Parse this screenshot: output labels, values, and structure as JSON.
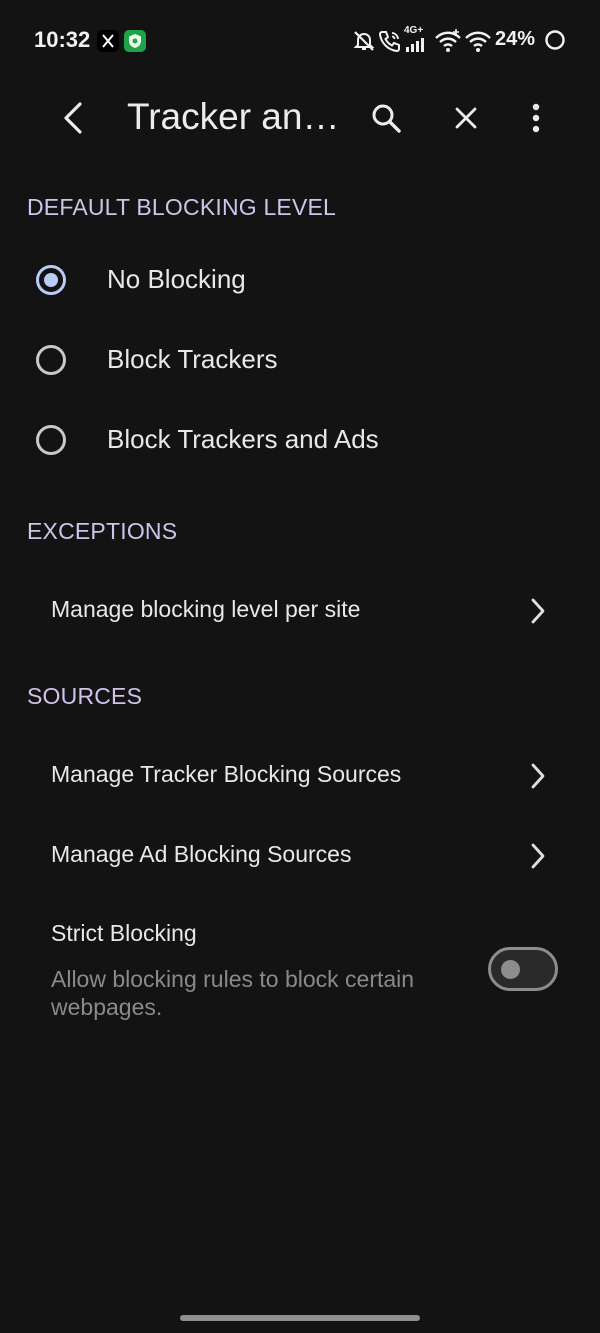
{
  "status_bar": {
    "time": "10:32",
    "network_label": "4G+",
    "battery": "24%",
    "icons": [
      "x-app-icon",
      "shield-app-icon",
      "mute-icon",
      "wifi-calling-icon",
      "signal-icon",
      "hotspot-icon",
      "wifi-icon",
      "battery-ring-icon"
    ]
  },
  "app_bar": {
    "title": "Tracker an…",
    "back_icon": "back-arrow-icon",
    "search_icon": "search-icon",
    "close_icon": "close-icon",
    "menu_icon": "overflow-menu-icon"
  },
  "default_blocking": {
    "header": "DEFAULT BLOCKING LEVEL",
    "options": [
      {
        "label": "No Blocking",
        "selected": true
      },
      {
        "label": "Block Trackers",
        "selected": false
      },
      {
        "label": "Block Trackers and Ads",
        "selected": false
      }
    ]
  },
  "exceptions": {
    "header": "EXCEPTIONS",
    "items": [
      {
        "label": "Manage blocking level per site"
      }
    ]
  },
  "sources": {
    "header": "SOURCES",
    "items": [
      {
        "label": "Manage Tracker Blocking Sources"
      },
      {
        "label": "Manage Ad Blocking Sources"
      }
    ],
    "strict": {
      "title": "Strict Blocking",
      "subtitle": "Allow blocking rules to block certain webpages.",
      "enabled": false
    }
  },
  "colors": {
    "background": "#131313",
    "section_header": "#cfc3ea",
    "radio_accent": "#b9cbf6",
    "secondary_text": "#8a8a8a"
  }
}
